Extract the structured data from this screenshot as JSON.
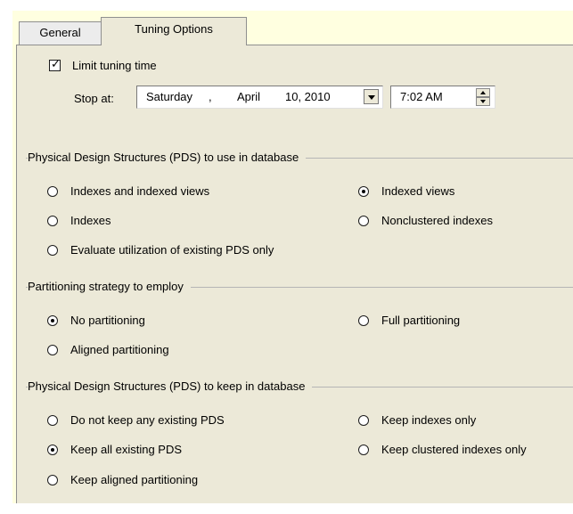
{
  "tabs": {
    "general": "General",
    "tuning": "Tuning Options"
  },
  "limit": {
    "checkbox_label": "Limit tuning time",
    "checked": true,
    "stop_at_label": "Stop at:",
    "date_day": "Saturday",
    "date_sep": ",",
    "date_month": "April",
    "date_daynum": "10, 2010",
    "time": "7:02 AM"
  },
  "pds_use": {
    "title": "Physical Design Structures (PDS) to use in database",
    "options": [
      {
        "label": "Indexes and indexed views",
        "checked": false
      },
      {
        "label": "Indexed views",
        "checked": true
      },
      {
        "label": "Indexes",
        "checked": false
      },
      {
        "label": "Nonclustered indexes",
        "checked": false
      },
      {
        "label": "Evaluate utilization of existing PDS only",
        "checked": false
      }
    ]
  },
  "partitioning": {
    "title": "Partitioning strategy to employ",
    "options": [
      {
        "label": "No partitioning",
        "checked": true
      },
      {
        "label": "Full partitioning",
        "checked": false
      },
      {
        "label": "Aligned partitioning",
        "checked": false
      }
    ]
  },
  "pds_keep": {
    "title": "Physical Design Structures (PDS) to keep in database",
    "options": [
      {
        "label": "Do not keep any existing PDS",
        "checked": false
      },
      {
        "label": "Keep indexes only",
        "checked": false
      },
      {
        "label": "Keep all existing PDS",
        "checked": true
      },
      {
        "label": "Keep clustered indexes only",
        "checked": false
      },
      {
        "label": "Keep aligned partitioning",
        "checked": false
      }
    ]
  }
}
